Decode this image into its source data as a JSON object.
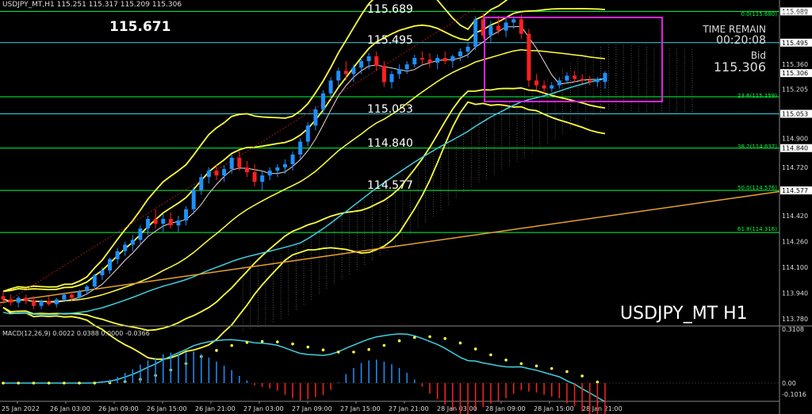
{
  "header": {
    "symbol_info": "USDJPY_MT,H1  115.251 115.317 115.209 115.306",
    "big_price": "115.671",
    "symbol_title": "USDJPY_MT H1",
    "time_remain_label": "TIME REMAIN",
    "time_remain_value": "00:20:08",
    "bid_label": "Bid",
    "bid_value": "115.306"
  },
  "level_labels": [
    "115.689",
    "115.495",
    "115.053",
    "114.840",
    "114.577"
  ],
  "fib_labels": [
    "0.0(115.680)",
    "23.6(115.159)",
    "38.2(114.837)",
    "50.0(114.576)",
    "61.8(114.316)"
  ],
  "macd_label": "MACD(12,26,9) 0.0022 0.0388 0.0000 -0.0366",
  "colors": {
    "background": "#000000",
    "bull_candle": "#1e90ff",
    "bear_candle": "#ff2020",
    "bands": "#ffff40",
    "hline": "#00ff40",
    "cyan": "#40d0e0",
    "orange": "#e8a030",
    "box": "#e020e0"
  },
  "chart_data": {
    "type": "candlestick",
    "title": "USDJPY_MT H1",
    "y_ticks": [
      "115.689",
      "115.680",
      "115.495",
      "115.360",
      "115.306",
      "115.205",
      "115.053",
      "114.900",
      "114.840",
      "114.720",
      "114.577",
      "114.420",
      "114.260",
      "114.100",
      "113.940",
      "113.780"
    ],
    "x_ticks": [
      "25 Jan 2022",
      "26 Jan 03:00",
      "26 Jan 09:00",
      "26 Jan 15:00",
      "26 Jan 21:00",
      "27 Jan 03:00",
      "27 Jan 09:00",
      "27 Jan 15:00",
      "27 Jan 21:00",
      "28 Jan 03:00",
      "28 Jan 09:00",
      "28 Jan 15:00",
      "28 Jan 21:00"
    ],
    "ylim": [
      113.74,
      115.76
    ],
    "horizontal_levels": [
      115.689,
      115.495,
      115.159,
      115.053,
      114.84,
      114.577,
      114.316
    ],
    "macd_ticks": [
      "0.3108",
      "0.00",
      "-0.1016"
    ],
    "candles": [
      [
        113.92,
        113.95,
        113.88,
        113.9
      ],
      [
        113.9,
        113.93,
        113.86,
        113.88
      ],
      [
        113.88,
        113.92,
        113.85,
        113.91
      ],
      [
        113.91,
        113.93,
        113.87,
        113.89
      ],
      [
        113.89,
        113.92,
        113.84,
        113.86
      ],
      [
        113.86,
        113.9,
        113.84,
        113.89
      ],
      [
        113.89,
        113.92,
        113.86,
        113.87
      ],
      [
        113.87,
        113.91,
        113.85,
        113.9
      ],
      [
        113.9,
        113.94,
        113.88,
        113.93
      ],
      [
        113.93,
        113.95,
        113.89,
        113.91
      ],
      [
        113.91,
        113.96,
        113.9,
        113.95
      ],
      [
        113.95,
        113.99,
        113.93,
        113.98
      ],
      [
        113.98,
        114.06,
        113.96,
        114.05
      ],
      [
        114.05,
        114.1,
        114.02,
        114.08
      ],
      [
        114.08,
        114.16,
        114.06,
        114.15
      ],
      [
        114.15,
        114.22,
        114.12,
        114.2
      ],
      [
        114.2,
        114.26,
        114.17,
        114.24
      ],
      [
        114.24,
        114.3,
        114.2,
        114.27
      ],
      [
        114.27,
        114.36,
        114.24,
        114.34
      ],
      [
        114.34,
        114.42,
        114.3,
        114.4
      ],
      [
        114.4,
        114.46,
        114.34,
        114.37
      ],
      [
        114.37,
        114.43,
        114.32,
        114.4
      ],
      [
        114.4,
        114.44,
        114.34,
        114.36
      ],
      [
        114.36,
        114.42,
        114.32,
        114.39
      ],
      [
        114.39,
        114.48,
        114.36,
        114.46
      ],
      [
        114.46,
        114.6,
        114.43,
        114.58
      ],
      [
        114.58,
        114.68,
        114.55,
        114.66
      ],
      [
        114.66,
        114.72,
        114.62,
        114.7
      ],
      [
        114.7,
        114.74,
        114.64,
        114.67
      ],
      [
        114.67,
        114.73,
        114.63,
        114.71
      ],
      [
        114.71,
        114.8,
        114.68,
        114.78
      ],
      [
        114.78,
        114.82,
        114.7,
        114.72
      ],
      [
        114.72,
        114.76,
        114.66,
        114.69
      ],
      [
        114.69,
        114.74,
        114.6,
        114.63
      ],
      [
        114.63,
        114.7,
        114.58,
        114.67
      ],
      [
        114.67,
        114.72,
        114.64,
        114.7
      ],
      [
        114.7,
        114.74,
        114.66,
        114.72
      ],
      [
        114.72,
        114.77,
        114.68,
        114.74
      ],
      [
        114.74,
        114.82,
        114.7,
        114.8
      ],
      [
        114.8,
        114.9,
        114.77,
        114.88
      ],
      [
        114.88,
        115.0,
        114.85,
        114.98
      ],
      [
        114.98,
        115.1,
        114.95,
        115.08
      ],
      [
        115.08,
        115.2,
        115.05,
        115.18
      ],
      [
        115.18,
        115.28,
        115.15,
        115.26
      ],
      [
        115.26,
        115.34,
        115.22,
        115.32
      ],
      [
        115.32,
        115.38,
        115.26,
        115.3
      ],
      [
        115.3,
        115.36,
        115.25,
        115.34
      ],
      [
        115.34,
        115.4,
        115.3,
        115.38
      ],
      [
        115.38,
        115.43,
        115.33,
        115.41
      ],
      [
        115.41,
        115.44,
        115.32,
        115.35
      ],
      [
        115.35,
        115.38,
        115.22,
        115.25
      ],
      [
        115.25,
        115.32,
        115.21,
        115.3
      ],
      [
        115.3,
        115.36,
        115.27,
        115.33
      ],
      [
        115.33,
        115.38,
        115.3,
        115.36
      ],
      [
        115.36,
        115.42,
        115.34,
        115.4
      ],
      [
        115.4,
        115.44,
        115.36,
        115.39
      ],
      [
        115.39,
        115.43,
        115.34,
        115.37
      ],
      [
        115.37,
        115.42,
        115.33,
        115.4
      ],
      [
        115.4,
        115.44,
        115.36,
        115.38
      ],
      [
        115.38,
        115.42,
        115.34,
        115.41
      ],
      [
        115.41,
        115.46,
        115.38,
        115.44
      ],
      [
        115.44,
        115.5,
        115.4,
        115.47
      ],
      [
        115.47,
        115.66,
        115.45,
        115.64
      ],
      [
        115.64,
        115.68,
        115.52,
        115.54
      ],
      [
        115.54,
        115.63,
        115.5,
        115.6
      ],
      [
        115.6,
        115.66,
        115.55,
        115.57
      ],
      [
        115.57,
        115.65,
        115.53,
        115.62
      ],
      [
        115.62,
        115.66,
        115.58,
        115.64
      ],
      [
        115.64,
        115.67,
        115.52,
        115.55
      ],
      [
        115.55,
        115.58,
        115.22,
        115.26
      ],
      [
        115.26,
        115.3,
        115.2,
        115.23
      ],
      [
        115.23,
        115.26,
        115.18,
        115.21
      ],
      [
        115.21,
        115.25,
        115.19,
        115.23
      ],
      [
        115.23,
        115.28,
        115.21,
        115.26
      ],
      [
        115.26,
        115.31,
        115.24,
        115.29
      ],
      [
        115.29,
        115.32,
        115.25,
        115.27
      ],
      [
        115.27,
        115.3,
        115.24,
        115.26
      ],
      [
        115.26,
        115.29,
        115.23,
        115.25
      ],
      [
        115.25,
        115.28,
        115.22,
        115.27
      ],
      [
        115.251,
        115.317,
        115.209,
        115.306
      ]
    ]
  }
}
